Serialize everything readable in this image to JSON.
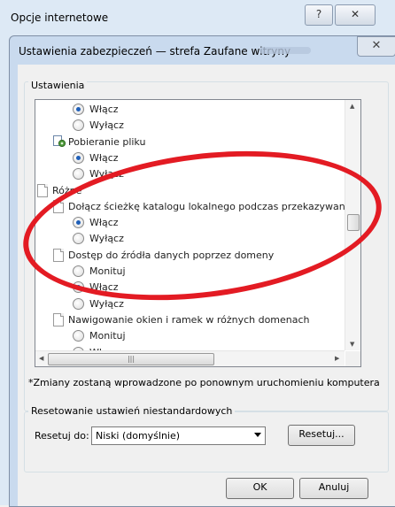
{
  "back_window": {
    "title": "Opcje internetowe",
    "help_glyph": "?",
    "close_glyph": "✕"
  },
  "dialog": {
    "title": "Ustawienia zabezpieczeń — strefa Zaufane witryny",
    "close_glyph": "✕",
    "settings_label": "Ustawienia",
    "items": [
      {
        "kind": "radio",
        "label": "Włącz",
        "checked": true
      },
      {
        "kind": "radio",
        "label": "Wyłącz",
        "checked": false
      },
      {
        "kind": "category",
        "label": "Pobieranie pliku",
        "icon": "page-settings-icon"
      },
      {
        "kind": "radio",
        "label": "Włącz",
        "checked": true
      },
      {
        "kind": "radio",
        "label": "Wyłącz",
        "checked": false
      },
      {
        "kind": "section",
        "label": "Różne",
        "icon": "document-icon"
      },
      {
        "kind": "category",
        "label": "Dołącz ścieżkę katalogu lokalnego podczas przekazywania pli",
        "icon": "document-icon"
      },
      {
        "kind": "radio",
        "label": "Włącz",
        "checked": true
      },
      {
        "kind": "radio",
        "label": "Wyłącz",
        "checked": false
      },
      {
        "kind": "category",
        "label": "Dostęp do źródła danych poprzez domeny",
        "icon": "document-icon"
      },
      {
        "kind": "radio",
        "label": "Monituj",
        "checked": false
      },
      {
        "kind": "radio",
        "label": "Włącz",
        "checked": true
      },
      {
        "kind": "radio",
        "label": "Wyłącz",
        "checked": false
      },
      {
        "kind": "category",
        "label": "Nawigowanie okien i ramek w różnych domenach",
        "icon": "document-icon"
      },
      {
        "kind": "radio",
        "label": "Monituj",
        "checked": false
      },
      {
        "kind": "radio",
        "label": "Włącz",
        "checked": true
      }
    ],
    "note": "*Zmiany zostaną wprowadzone po ponownym uruchomieniu komputera",
    "reset_group_label": "Resetowanie ustawień niestandardowych",
    "reset_to_label": "Resetuj do:",
    "reset_select_value": "Niski (domyślnie)",
    "reset_button": "Resetuj...",
    "ok_button": "OK",
    "cancel_button": "Anuluj"
  },
  "annotation_color": "#e31b23"
}
